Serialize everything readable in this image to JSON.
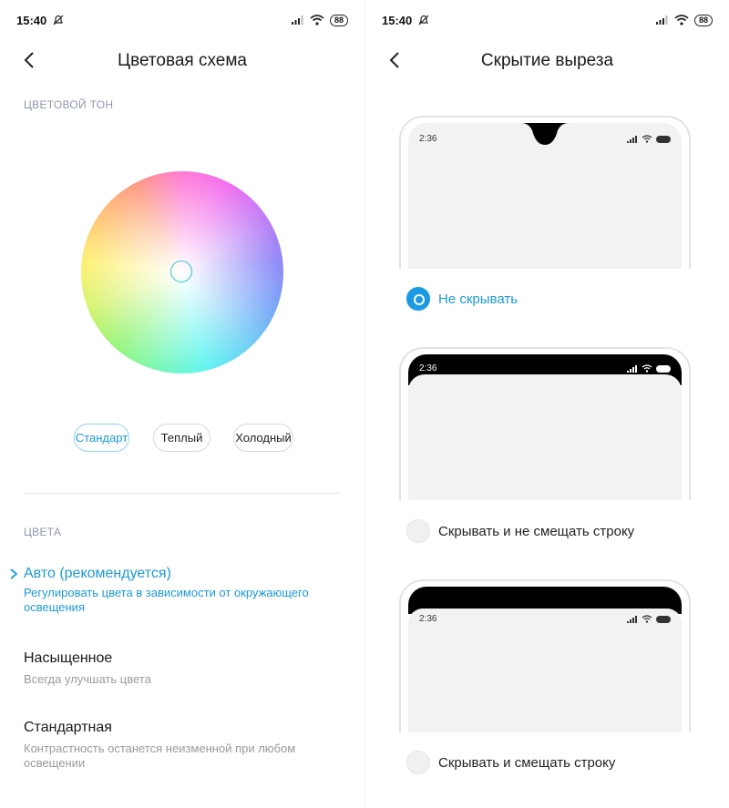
{
  "left": {
    "status": {
      "time": "15:40",
      "battery": "88"
    },
    "title": "Цветовая схема",
    "tone_label": "ЦВЕТОВОЙ ТОН",
    "chips": [
      "Стандарт",
      "Теплый",
      "Холодный"
    ],
    "colors_label": "ЦВЕТА",
    "options": [
      {
        "title": "Авто (рекомендуется)",
        "subtitle": "Регулировать цвета в зависимости от окружающего освещения",
        "selected": true
      },
      {
        "title": "Насыщенное",
        "subtitle": "Всегда улучшать цвета",
        "selected": false
      },
      {
        "title": "Стандартная",
        "subtitle": "Контрастность останется неизменной при любом освещении",
        "selected": false
      }
    ]
  },
  "right": {
    "status": {
      "time": "15:40",
      "battery": "88"
    },
    "title": "Скрытие выреза",
    "previews": [
      {
        "time": "2:36",
        "label": "Не скрывать",
        "checked": true
      },
      {
        "time": "2:36",
        "label": "Скрывать и не смещать строку",
        "checked": false
      },
      {
        "time": "2:36",
        "label": "Скрывать и смещать строку",
        "checked": false
      }
    ]
  },
  "colors": {
    "accent": "#1c9ad6",
    "radio_on": "#1a9ae3",
    "section_label": "#8d98a9"
  },
  "icons": {
    "back": "chevron-left-icon",
    "silence": "bell-off-icon",
    "signal": "signal-icon",
    "wifi": "wifi-icon",
    "battery": "battery-icon"
  }
}
